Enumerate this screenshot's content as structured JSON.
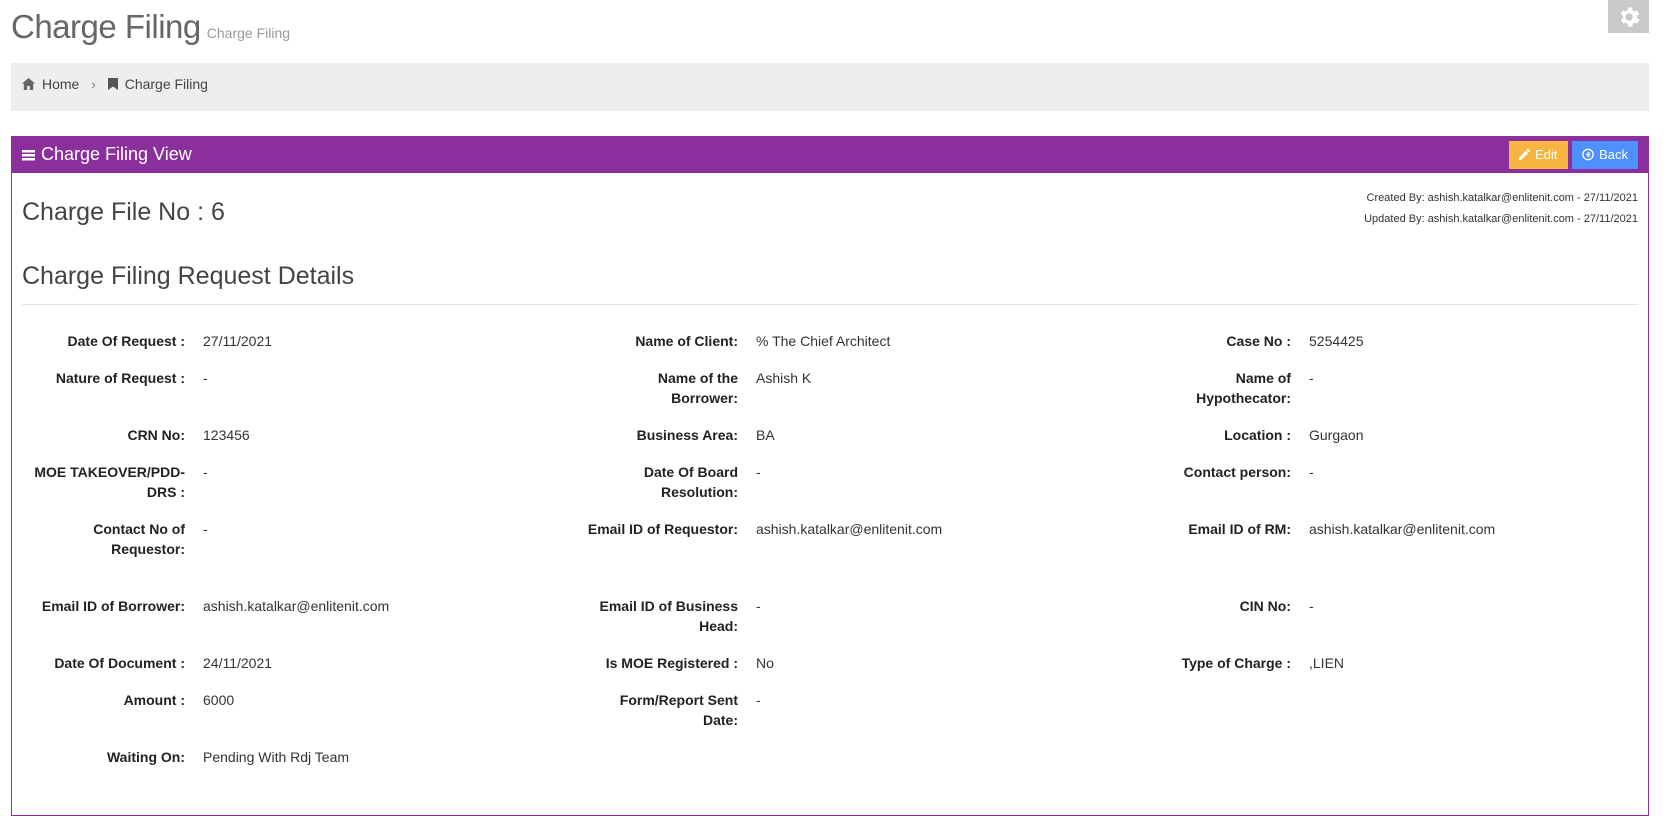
{
  "page": {
    "title": "Charge Filing",
    "subtitle": "Charge Filing"
  },
  "breadcrumb": {
    "home": "Home",
    "current": "Charge Filing"
  },
  "portlet": {
    "title": "Charge Filing View",
    "edit_label": "Edit",
    "back_label": "Back",
    "created_by": "Created By: ashish.katalkar@enlitenit.com - 27/11/2021",
    "updated_by": "Updated By: ashish.katalkar@enlitenit.com - 27/11/2021",
    "file_no": "Charge File No : 6",
    "section_title": "Charge Filing Request Details"
  },
  "fields": [
    {
      "label": "Date Of Request :",
      "value": "27/11/2021"
    },
    {
      "label": "Name of Client:",
      "value": "% The Chief Architect"
    },
    {
      "label": "Case No :",
      "value": "5254425"
    },
    {
      "label": "Nature of Request :",
      "value": "-"
    },
    {
      "label": "Name of the Borrower:",
      "value": "Ashish K"
    },
    {
      "label": "Name of Hypothecator:",
      "value": "-"
    },
    {
      "label": "CRN No:",
      "value": "123456"
    },
    {
      "label": "Business Area:",
      "value": "BA"
    },
    {
      "label": "Location :",
      "value": "Gurgaon"
    },
    {
      "label": "MOE TAKEOVER/PDD-DRS :",
      "value": "-"
    },
    {
      "label": "Date Of Board Resolution:",
      "value": "-"
    },
    {
      "label": "Contact person:",
      "value": "-"
    },
    {
      "label": "Contact No of Requestor:",
      "value": "-"
    },
    {
      "label": "Email ID of Requestor:",
      "value": "ashish.katalkar@enlitenit.com"
    },
    {
      "label": "Email ID of RM:",
      "value": "ashish.katalkar@enlitenit.com"
    },
    {
      "label": "Email ID of Borrower:",
      "value": "ashish.katalkar@enlitenit.com"
    },
    {
      "label": "Email ID of Business Head:",
      "value": "-"
    },
    {
      "label": "CIN No:",
      "value": "-"
    },
    {
      "label": "Date Of Document :",
      "value": "24/11/2021"
    },
    {
      "label": "Is MOE Registered :",
      "value": "No"
    },
    {
      "label": "Type of Charge :",
      "value": ",LIEN"
    },
    {
      "label": "Amount :",
      "value": "6000"
    },
    {
      "label": "Form/Report Sent Date:",
      "value": "-"
    },
    {
      "label": "Waiting On:",
      "value": "Pending With Rdj Team"
    }
  ]
}
